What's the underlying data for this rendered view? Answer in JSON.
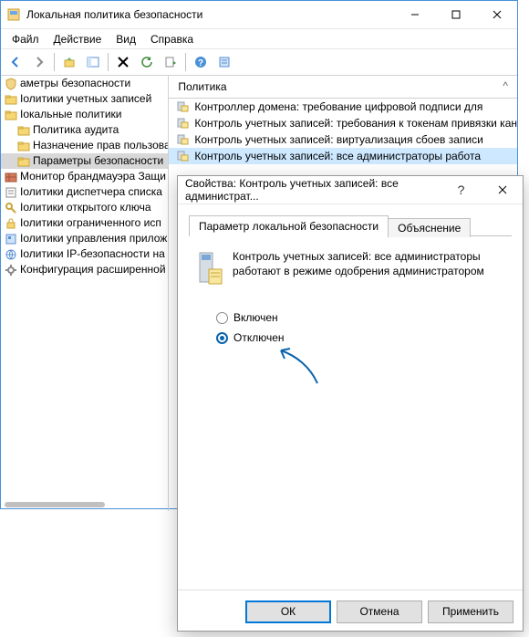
{
  "window": {
    "title": "Локальная политика безопасности",
    "menu": [
      "Файл",
      "Действие",
      "Вид",
      "Справка"
    ]
  },
  "tree": [
    {
      "label": "аметры безопасности",
      "icon": "shield"
    },
    {
      "label": "Іолитики учетных записей",
      "icon": "folder"
    },
    {
      "label": "Іокальные политики",
      "icon": "folder"
    },
    {
      "label": "Политика аудита",
      "icon": "folder",
      "indent": 1
    },
    {
      "label": "Назначение прав пользовате",
      "icon": "folder",
      "indent": 1
    },
    {
      "label": "Параметры безопасности",
      "icon": "folder",
      "indent": 1,
      "selected": true
    },
    {
      "label": "Монитор брандмауэра Защи",
      "icon": "wall"
    },
    {
      "label": "Іолитики диспетчера списка",
      "icon": "list"
    },
    {
      "label": "Іолитики открытого ключа",
      "icon": "key"
    },
    {
      "label": "Іолитики ограниченного исп",
      "icon": "lock"
    },
    {
      "label": "Іолитики управления прилож",
      "icon": "app"
    },
    {
      "label": "Іолитики IP-безопасности на",
      "icon": "net"
    },
    {
      "label": "Конфигурация расширенной",
      "icon": "gear"
    }
  ],
  "list": {
    "header": "Политика",
    "items": [
      {
        "label": "Контроллер домена: требование цифровой подписи для"
      },
      {
        "label": "Контроль учетных записей: требования к токенам привязки кан"
      },
      {
        "label": "Контроль учетных записей: виртуализация сбоев записи"
      },
      {
        "label": "Контроль учетных записей: все администраторы работа",
        "selected": true
      }
    ]
  },
  "dialog": {
    "title": "Свойства: Контроль учетных записей: все администрат...",
    "tabs": {
      "active": "Параметр локальной безопасности",
      "other": "Объяснение"
    },
    "policy_text": "Контроль учетных записей: все администраторы работают в режиме одобрения администратором",
    "radios": {
      "on": "Включен",
      "off": "Отключен",
      "selected": "off"
    },
    "buttons": {
      "ok": "ОК",
      "cancel": "Отмена",
      "apply": "Применить"
    }
  }
}
